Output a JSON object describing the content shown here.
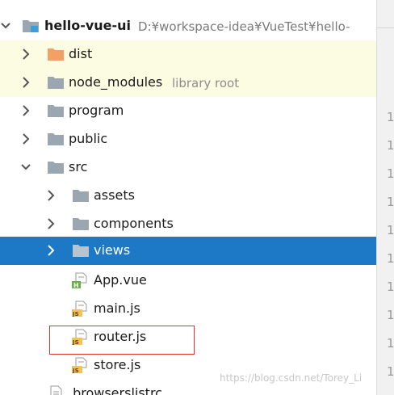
{
  "project": {
    "name": "hello-vue-ui",
    "path": "D:¥workspace-idea¥VueTest¥hello-"
  },
  "items": {
    "dist": "dist",
    "node_modules": "node_modules",
    "node_modules_hint": "library root",
    "program": "program",
    "public": "public",
    "src": "src",
    "assets": "assets",
    "components": "components",
    "views": "views",
    "app_vue": "App.vue",
    "main_js": "main.js",
    "router_js": "router.js",
    "store_js": "store.js",
    "browserslistrc": ".browserslistrc"
  },
  "gutter": {
    "line_digit": "1"
  },
  "watermark": "https://blog.csdn.net/Torey_Li",
  "icon_names": {
    "expanded": "chevron-down-icon",
    "collapsed": "chevron-right-icon",
    "folder": "folder-icon",
    "excluded_folder": "excluded-folder-icon",
    "vue_file": "vue-file-icon",
    "js_file": "js-file-icon",
    "config_file": "config-file-icon"
  },
  "colors": {
    "selection": "#1d79c6",
    "highlight_row": "#fcfce2",
    "excluded_folder": "#f0a163",
    "folder": "#9aa7b0",
    "annotation_box": "#d9362b"
  }
}
